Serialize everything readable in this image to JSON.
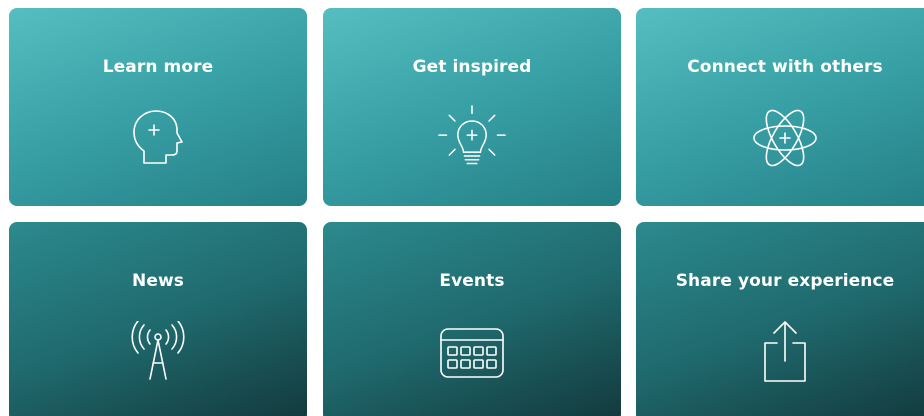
{
  "cards": [
    {
      "title": "Learn more",
      "icon": "head-plus-icon"
    },
    {
      "title": "Get inspired",
      "icon": "lightbulb-icon"
    },
    {
      "title": "Connect with others",
      "icon": "atom-icon"
    },
    {
      "title": "News",
      "icon": "radio-tower-icon"
    },
    {
      "title": "Events",
      "icon": "calendar-icon"
    },
    {
      "title": "Share your experience",
      "icon": "share-upload-icon"
    }
  ],
  "colors": {
    "top_gradient": [
      "#55bec0",
      "#247f86"
    ],
    "bottom_gradient": [
      "#2c8a8d",
      "#13393c"
    ],
    "text": "#ffffff"
  }
}
